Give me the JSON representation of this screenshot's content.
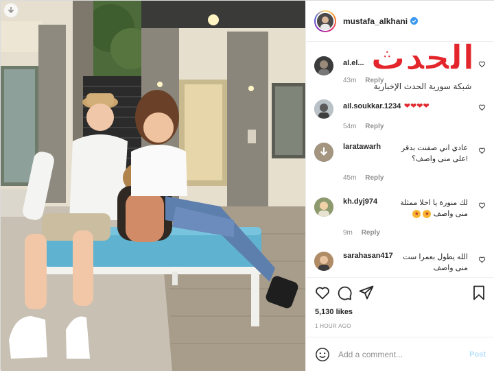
{
  "post": {
    "owner_username": "mustafa_alkhani",
    "verified": true,
    "likes_text": "5,130 likes",
    "time_ago": "1 HOUR AGO"
  },
  "watermark": {
    "logo_text": "الحدث",
    "subtitle": "شبكة سورية الحدث الإخبارية"
  },
  "comments": [
    {
      "username": "al.el...",
      "text": "",
      "time": "43m",
      "reply_label": "Reply",
      "emoji": ""
    },
    {
      "username": "ail.soukkar.1234",
      "text": "",
      "time": "54m",
      "reply_label": "Reply",
      "emoji": "❤❤❤❤"
    },
    {
      "username": "larataw...",
      "text_line1": "عادي اني صفنت بدقر",
      "text_line2": "!على منى واصف؟",
      "username_full": "larata...",
      "time": "45m",
      "reply_label": "Reply"
    },
    {
      "username": "kh.dyj974",
      "text_line1": "لك منورة يا احلا ممثلة",
      "text_line2": "منى واصف",
      "time": "9m",
      "reply_label": "Reply"
    },
    {
      "username": "sarahasan417",
      "text_line1": "الله يطول بعمرا ست",
      "text_line2": "منى واصف",
      "time": "",
      "reply_label": ""
    }
  ],
  "add_comment": {
    "placeholder": "Add a comment...",
    "post_label": "Post"
  },
  "icons": {
    "download": "download-icon",
    "like": "heart-icon",
    "comment": "comment-icon",
    "share": "share-icon",
    "save": "bookmark-icon",
    "emoji": "smiley-icon",
    "verified": "verified-badge-icon"
  },
  "colors": {
    "verified_blue": "#3897f0",
    "watermark_red": "#e3262c",
    "post_disabled": "#b2dffc",
    "secondary_text": "#8e8e8e"
  }
}
